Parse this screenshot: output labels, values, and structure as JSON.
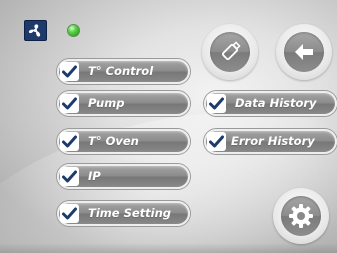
{
  "header": {
    "logo_icon": "fan-icon",
    "status_led_color": "#3ec22f"
  },
  "left_menu": {
    "items": [
      {
        "label": "T° Control",
        "checked": true
      },
      {
        "label": "Pump",
        "checked": true
      },
      {
        "label": "T° Oven",
        "checked": true
      },
      {
        "label": "IP",
        "checked": true
      },
      {
        "label": "Time Setting",
        "checked": true
      }
    ]
  },
  "right_menu": {
    "items": [
      {
        "label": "Data History",
        "checked": true
      },
      {
        "label": "Error History",
        "checked": true
      }
    ]
  },
  "buttons": {
    "usb_icon": "usb-drive-icon",
    "back_icon": "arrow-left-icon",
    "settings_icon": "gear-icon"
  },
  "colors": {
    "check_mark": "#1d3a6b",
    "pill_text": "#ffffff"
  }
}
